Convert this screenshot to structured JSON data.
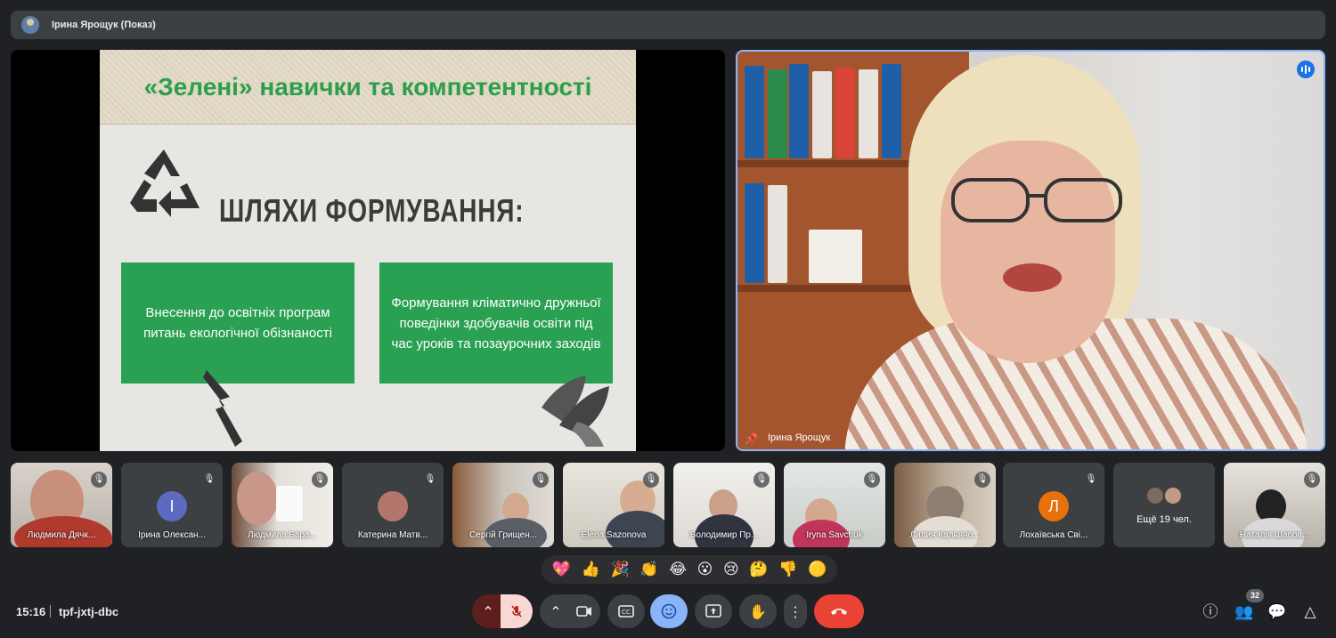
{
  "topbar": {
    "presenter_title": "Ірина Ярощук (Показ)"
  },
  "slide": {
    "title": "«Зелені» навички та компетентності",
    "subtitle": "ШЛЯХИ ФОРМУВАННЯ:",
    "box1": "Внесення до освітніх програм  питань екологічної обізнаності",
    "box2": "Формування кліматично дружньої поведінки здобувачів освіти під час уроків та позаурочних заходів",
    "accent_color": "#2aa053"
  },
  "main_video": {
    "name": "Ірина Ярощук"
  },
  "participants": [
    {
      "name": "Людмила Дячк...",
      "muted": true,
      "type": "video"
    },
    {
      "name": "Ірина Олексан...",
      "muted": true,
      "type": "avatar",
      "initial": "І",
      "color": "#5c6bc0"
    },
    {
      "name": "Людмила Бара...",
      "muted": true,
      "type": "video"
    },
    {
      "name": "Катерина Матв...",
      "muted": true,
      "type": "photo"
    },
    {
      "name": "Сергій Грищен...",
      "muted": true,
      "type": "video"
    },
    {
      "name": "Elena Sazonova",
      "muted": true,
      "type": "video"
    },
    {
      "name": "Володимир Пр...",
      "muted": true,
      "type": "video"
    },
    {
      "name": "Iryna Savchuk",
      "muted": true,
      "type": "video"
    },
    {
      "name": "Лилия Кальяно...",
      "muted": true,
      "type": "video"
    },
    {
      "name": "Лохаївська Сві...",
      "muted": true,
      "type": "avatar",
      "initial": "Л",
      "color": "#e8710a"
    },
    {
      "name": "Ещё 19 чел.",
      "muted": false,
      "type": "more"
    },
    {
      "name": "Наталія Шапов...",
      "muted": true,
      "type": "video"
    }
  ],
  "reactions": [
    "💖",
    "👍",
    "🎉",
    "👏",
    "😂",
    "😮",
    "😢",
    "🤔",
    "👎",
    "🟡"
  ],
  "bottom": {
    "time": "15:16",
    "meeting_code": "tpf-jxtj-dbc",
    "people_count": "32"
  },
  "colors": {
    "end_call": "#ea4335",
    "active_blue": "#8ab4f8",
    "mic_off_bg": "#f8d7d5"
  },
  "icons": [
    "chevron-up-icon",
    "mic-off-icon",
    "camera-icon",
    "captions-icon",
    "emoji-icon",
    "present-icon",
    "hand-icon",
    "more-vert-icon",
    "end-call-icon",
    "info-icon",
    "people-icon",
    "chat-icon",
    "activities-icon"
  ]
}
